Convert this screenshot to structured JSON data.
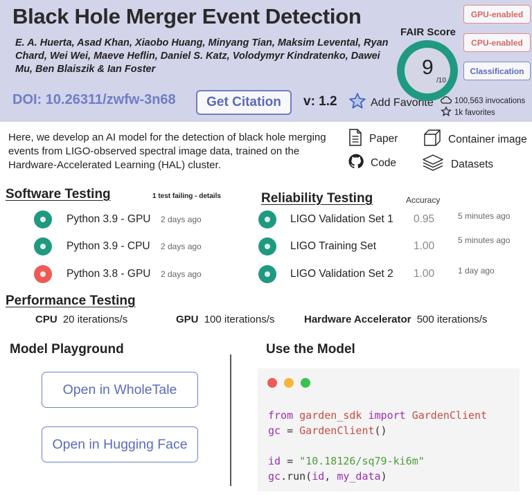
{
  "header": {
    "title": "Black Hole Merger Event Detection",
    "authors": "E. A. Huerta, Asad Khan, Xiaobo Huang, Minyang Tian, Maksim Levental, Ryan Chard, Wei Wei, Maeve Heflin, Daniel S. Katz, Volodymyr Kindratenko, Dawei Mu, Ben Blaiszik & Ian Foster",
    "doi": "DOI: 10.26311/zwfw-3n68",
    "get_citation": "Get Citation",
    "version": "v: 1.2",
    "add_favorite": "Add Favorite",
    "invocations": "100,563 invocations",
    "favorites": "1k favorites",
    "fair_label": "FAIR Score",
    "fair_score": "9",
    "fair_denominator": "/10",
    "fair_ratio": 0.9,
    "tags": [
      "GPU-enabled",
      "CPU-enabled",
      "Classification"
    ]
  },
  "description": "Here, we develop an AI model for the detection of black hole merging events from LIGO-observed spectral image data, trained on the Hardware-Accelerated Learning (HAL) cluster.",
  "links": {
    "paper": "Paper",
    "container": "Container image",
    "code": "Code",
    "datasets": "Datasets"
  },
  "software_testing": {
    "heading": "Software Testing",
    "note": "1 test failing - details",
    "tests": [
      {
        "name": "Python 3.9 - GPU",
        "time": "2 days ago",
        "status": "pass"
      },
      {
        "name": "Python 3.9 - CPU",
        "time": "2 days ago",
        "status": "pass"
      },
      {
        "name": "Python 3.8 - GPU",
        "time": "2 days ago",
        "status": "fail"
      }
    ]
  },
  "reliability_testing": {
    "heading": "Reliability Testing",
    "accuracy_label": "Accuracy",
    "tests": [
      {
        "name": "LIGO Validation Set 1",
        "accuracy": "0.95",
        "time": "5 minutes ago"
      },
      {
        "name": "LIGO Training Set",
        "accuracy": "1.00",
        "time": "5 minutes ago"
      },
      {
        "name": "LIGO Validation Set 2",
        "accuracy": "1.00",
        "time": "1 day ago"
      }
    ]
  },
  "performance_testing": {
    "heading": "Performance Testing",
    "items": [
      {
        "label": "CPU",
        "value": "20 iterations/s"
      },
      {
        "label": "GPU",
        "value": "100 iterations/s"
      },
      {
        "label": "Hardware Accelerator",
        "value": "500 iterations/s"
      }
    ]
  },
  "playground": {
    "heading": "Model Playground",
    "wholetale": "Open in WholeTale",
    "huggingface": "Open in Hugging Face"
  },
  "use_model": {
    "heading": "Use the Model",
    "code": {
      "from": "from",
      "module": "garden_sdk",
      "import": "import",
      "class_name": "GardenClient",
      "gc": "gc",
      "eq": "=",
      "ctor": "GardenClient",
      "ctor_parens": "()",
      "id_var": "id",
      "id_value": "\"10.18126/sq79-ki6m\"",
      "run_obj": "gc",
      "run_fn": ".run(",
      "run_arg1": "id",
      "run_sep": ", ",
      "run_arg2": "my_data",
      "run_close": ")"
    },
    "window_dots": [
      "#ee5b57",
      "#f5b63a",
      "#3cc151"
    ]
  },
  "colors": {
    "header_bg": "#d2d4ea",
    "accent_blue": "#6f7dc4",
    "pass_green": "#1f9a80",
    "fail_red": "#ee5b57"
  }
}
